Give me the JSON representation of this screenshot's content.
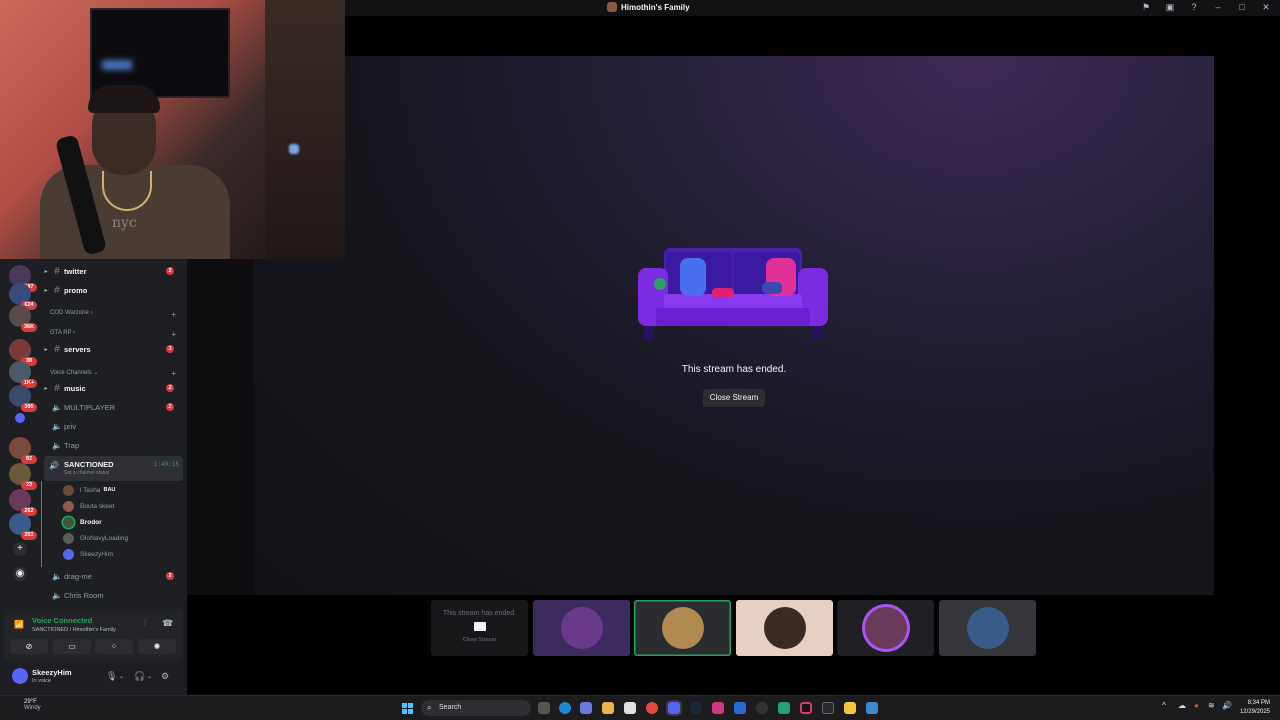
{
  "window": {
    "title": "Himothin's Family",
    "controls": [
      "flag-icon",
      "inbox-icon",
      "help-icon",
      "minimize-icon",
      "maximize-icon",
      "close-icon"
    ]
  },
  "webcam": {
    "shirt_text": "nyc"
  },
  "servers": [
    {
      "badge": "187"
    },
    {
      "badge": "624"
    },
    {
      "badge": "36K"
    },
    {
      "badge": "38"
    },
    {
      "badge": "1K+"
    },
    {
      "badge": "395"
    },
    {
      "badge": ""
    },
    {
      "badge": "82"
    },
    {
      "badge": "23"
    },
    {
      "badge": "262"
    },
    {
      "badge": "251"
    }
  ],
  "sidebar": {
    "channels": [
      {
        "name": "twitter",
        "type": "text",
        "badge": "2"
      },
      {
        "name": "promo",
        "type": "text",
        "badge": ""
      }
    ],
    "category_warzone": "COD Warzone",
    "category_gta": "GTA RP",
    "servers_channel": {
      "name": "servers",
      "badge": "3"
    },
    "category_voice": "Voice Channels",
    "music_channel": {
      "name": "music",
      "badge": "2"
    },
    "voice_channels": [
      {
        "name": "MULTIPLAYER",
        "badge": "2"
      },
      {
        "name": "priv",
        "badge": ""
      },
      {
        "name": "Trap",
        "badge": ""
      }
    ],
    "active_voice": {
      "name": "SANCTIONED",
      "status": "Set a channel status",
      "timer": "1:49:15"
    },
    "members": [
      {
        "name": "l Tasha",
        "tag": "BAU",
        "color": "#6b4a3a"
      },
      {
        "name": "Bouta skeet",
        "tag": "",
        "color": "#8a5a4a"
      },
      {
        "name": "Brodor",
        "tag": "",
        "color": "#3a5a3a"
      },
      {
        "name": "GloNavyLoading",
        "tag": "",
        "color": "#5a5a5a"
      },
      {
        "name": "SkeezyHim",
        "tag": "",
        "color": "#5865f2"
      }
    ],
    "after_voice": [
      {
        "name": "drag-me",
        "badge": "2"
      },
      {
        "name": "Chris Room",
        "badge": ""
      }
    ]
  },
  "voice_panel": {
    "title": "Voice Connected",
    "subtitle": "SANCTIONED / Himothin's Family"
  },
  "user_panel": {
    "username": "SkeezyHim",
    "status": "In voice"
  },
  "stage": {
    "ended_text": "This stream has ended.",
    "close_label": "Close Stream"
  },
  "strip": {
    "ended_text": "This stream has ended.",
    "close_label": "Close Stream",
    "tiles": [
      {
        "bg": "#3d2a5e",
        "avatar": "#6a3a8a"
      },
      {
        "bg": "#2a2c30",
        "avatar": "#b08a50"
      },
      {
        "bg": "#e8cfc4",
        "avatar": "#3a2a24"
      },
      {
        "bg": "#202024",
        "avatar": "#6a3a5a"
      },
      {
        "bg": "#34363c",
        "avatar": "#3a5a8a"
      }
    ]
  },
  "taskbar": {
    "weather_temp": "29°F",
    "weather_desc": "Windy",
    "search_label": "Search",
    "time": "8:34 PM",
    "date": "12/29/2025"
  }
}
